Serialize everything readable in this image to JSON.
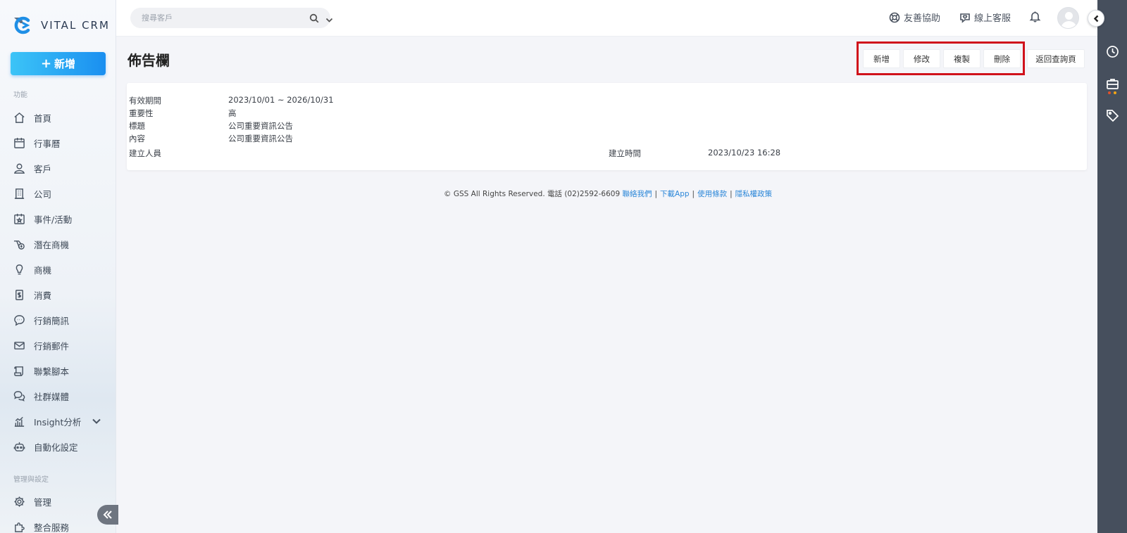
{
  "brand": {
    "name": "VITAL CRM"
  },
  "sidebar": {
    "new_button": "新增",
    "section_functions": "功能",
    "section_admin": "管理與設定",
    "items": [
      {
        "label": "首頁",
        "icon": "home-icon"
      },
      {
        "label": "行事曆",
        "icon": "calendar-icon"
      },
      {
        "label": "客戶",
        "icon": "user-icon"
      },
      {
        "label": "公司",
        "icon": "building-icon"
      },
      {
        "label": "事件/活動",
        "icon": "event-icon"
      },
      {
        "label": "潛在商機",
        "icon": "prospect-icon"
      },
      {
        "label": "商機",
        "icon": "lightbulb-icon"
      },
      {
        "label": "消費",
        "icon": "receipt-icon"
      },
      {
        "label": "行銷簡訊",
        "icon": "sms-icon"
      },
      {
        "label": "行銷郵件",
        "icon": "mail-icon"
      },
      {
        "label": "聯繫腳本",
        "icon": "script-icon"
      },
      {
        "label": "社群媒體",
        "icon": "chat-icon"
      },
      {
        "label": "Insight分析",
        "icon": "chart-icon"
      },
      {
        "label": "自動化設定",
        "icon": "robot-icon"
      }
    ],
    "admin_items": [
      {
        "label": "管理",
        "icon": "gear-icon"
      },
      {
        "label": "整合服務",
        "icon": "puzzle-icon"
      }
    ]
  },
  "topbar": {
    "search_placeholder": "搜尋客戶",
    "help_link": "友善協助",
    "support_link": "線上客服"
  },
  "page": {
    "title": "佈告欄",
    "actions": {
      "add": "新增",
      "edit": "修改",
      "copy": "複製",
      "delete": "刪除",
      "back": "返回查詢頁"
    }
  },
  "record": {
    "period_label": "有效期間",
    "period_value": "2023/10/01 ~ 2026/10/31",
    "importance_label": "重要性",
    "importance_value": "高",
    "subject_label": "標題",
    "subject_value": "公司重要資訊公告",
    "content_label": "內容",
    "content_value": "公司重要資訊公告",
    "creator_label": "建立人員",
    "creator_value": "",
    "created_time_label": "建立時間",
    "created_time_value": "2023/10/23 16:28"
  },
  "footer": {
    "copyright": "© GSS All Rights Reserved. 電話 (02)2592-6609",
    "contact": "聯絡我們",
    "download": "下載App",
    "terms": "使用條款",
    "privacy": "隱私權政策",
    "separator": "|"
  },
  "colors": {
    "accent_start": "#3cc4f7",
    "accent_end": "#1a8ff0",
    "highlight_border": "#d0121b",
    "rail_bg": "#464f5d",
    "link": "#2a86d8"
  }
}
